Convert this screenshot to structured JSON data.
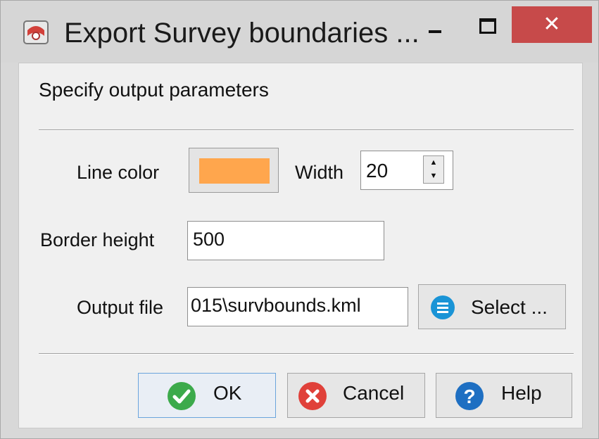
{
  "window": {
    "title": "Export Survey boundaries ...",
    "icons": {
      "app": "survey-app-icon",
      "minimize": "minimize-icon",
      "maximize": "maximize-icon",
      "close": "close-icon"
    },
    "close_glyph": "✕"
  },
  "dialog": {
    "heading": "Specify output parameters",
    "line_color_label": "Line color",
    "line_color_value": "#ffa64d",
    "width_label": "Width",
    "width_value": "20",
    "border_height_label": "Border height",
    "border_height_value": "500",
    "output_file_label": "Output file",
    "output_file_value": "015\\survbounds.kml",
    "select_label": "Select ...",
    "spinner_up": "▲",
    "spinner_down": "▼"
  },
  "buttons": {
    "ok_label": "OK",
    "cancel_label": "Cancel",
    "help_label": "Help"
  },
  "colors": {
    "ok_icon": "#3caa4b",
    "cancel_icon": "#e0413a",
    "help_icon": "#1e6fc2",
    "select_icon": "#1a94d6",
    "close_button": "#c74a4a"
  }
}
